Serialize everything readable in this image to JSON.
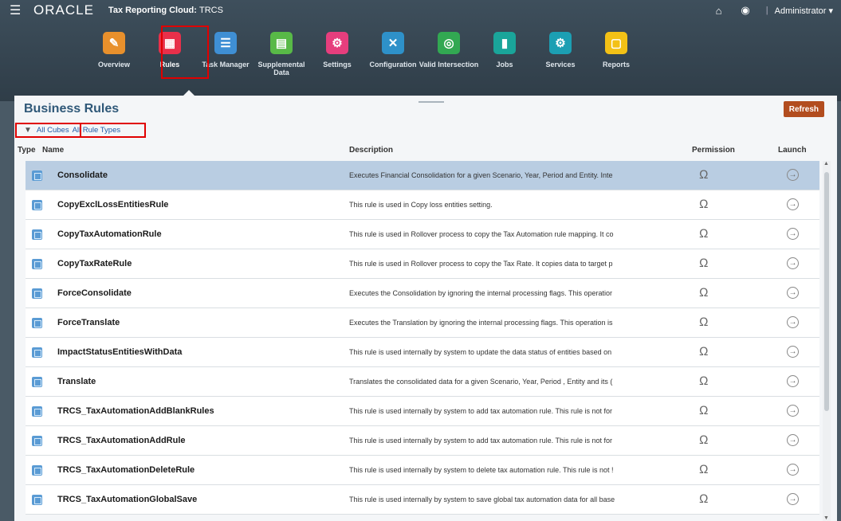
{
  "header": {
    "menu_icon": "hamburger-icon",
    "logo": "ORACLE",
    "app_title": "Tax Reporting Cloud:",
    "app_subtitle": "TRCS",
    "home_icon": "home-icon",
    "accessibility_icon": "accessibility-icon",
    "user_menu": "Administrator ▾"
  },
  "nav": [
    {
      "label": "Overview",
      "icon": "overview-icon",
      "color": "#e8902c",
      "glyph": "✎"
    },
    {
      "label": "Rules",
      "icon": "rules-icon",
      "color": "#e8304a",
      "glyph": "▦"
    },
    {
      "label": "Task Manager",
      "icon": "task-manager-icon",
      "color": "#3f8fd4",
      "glyph": "☰"
    },
    {
      "label": "Supplemental Data",
      "icon": "supplemental-data-icon",
      "color": "#58b947",
      "glyph": "▤"
    },
    {
      "label": "Settings",
      "icon": "settings-icon",
      "color": "#e63e7d",
      "glyph": "⚙"
    },
    {
      "label": "Configuration",
      "icon": "configuration-icon",
      "color": "#2e91c9",
      "glyph": "✕"
    },
    {
      "label": "Valid Intersection",
      "icon": "valid-intersection-icon",
      "color": "#32a852",
      "glyph": "◎"
    },
    {
      "label": "Jobs",
      "icon": "jobs-icon",
      "color": "#1aa59a",
      "glyph": "▮"
    },
    {
      "label": "Services",
      "icon": "services-icon",
      "color": "#1c9fb3",
      "glyph": "⚙"
    },
    {
      "label": "Reports",
      "icon": "reports-icon",
      "color": "#f3c116",
      "glyph": "▢"
    }
  ],
  "page": {
    "title": "Business Rules",
    "refresh": "Refresh",
    "filter_cubes": "All Cubes",
    "filter_types": "All Rule Types"
  },
  "columns": {
    "type": "Type",
    "name": "Name",
    "description": "Description",
    "permission": "Permission",
    "launch": "Launch"
  },
  "rows": [
    {
      "name": "Consolidate",
      "description": "Executes Financial Consolidation for a given Scenario, Year, Period and Entity. Inte"
    },
    {
      "name": "CopyExclLossEntitiesRule",
      "description": "This rule is used in Copy loss entities setting."
    },
    {
      "name": "CopyTaxAutomationRule",
      "description": "This rule is used in Rollover process to copy the Tax Automation rule mapping. It co"
    },
    {
      "name": "CopyTaxRateRule",
      "description": "This rule is used in Rollover process to copy the Tax Rate. It copies data to target p"
    },
    {
      "name": "ForceConsolidate",
      "description": "Executes the Consolidation by ignoring the internal processing flags. This operatior"
    },
    {
      "name": "ForceTranslate",
      "description": "Executes the Translation by ignoring the internal processing flags. This operation is"
    },
    {
      "name": "ImpactStatusEntitiesWithData",
      "description": "This rule is used internally by system to update the data status of entities based on"
    },
    {
      "name": "Translate",
      "description": "Translates the consolidated data for a given Scenario, Year, Period , Entity and its ("
    },
    {
      "name": "TRCS_TaxAutomationAddBlankRules",
      "description": "This rule is used internally by system to add tax automation rule. This rule is not for"
    },
    {
      "name": "TRCS_TaxAutomationAddRule",
      "description": "This rule is used internally by system to add tax automation rule. This rule is not for"
    },
    {
      "name": "TRCS_TaxAutomationDeleteRule",
      "description": "This rule is used internally by system to delete tax automation rule. This rule is not !"
    },
    {
      "name": "TRCS_TaxAutomationGlobalSave",
      "description": "This rule is used internally by system to save global tax automation data for all base"
    }
  ],
  "row_icons": {
    "type": "business-rule-icon",
    "permission": "permission-icon",
    "launch": "launch-icon"
  },
  "selected_row": 0
}
